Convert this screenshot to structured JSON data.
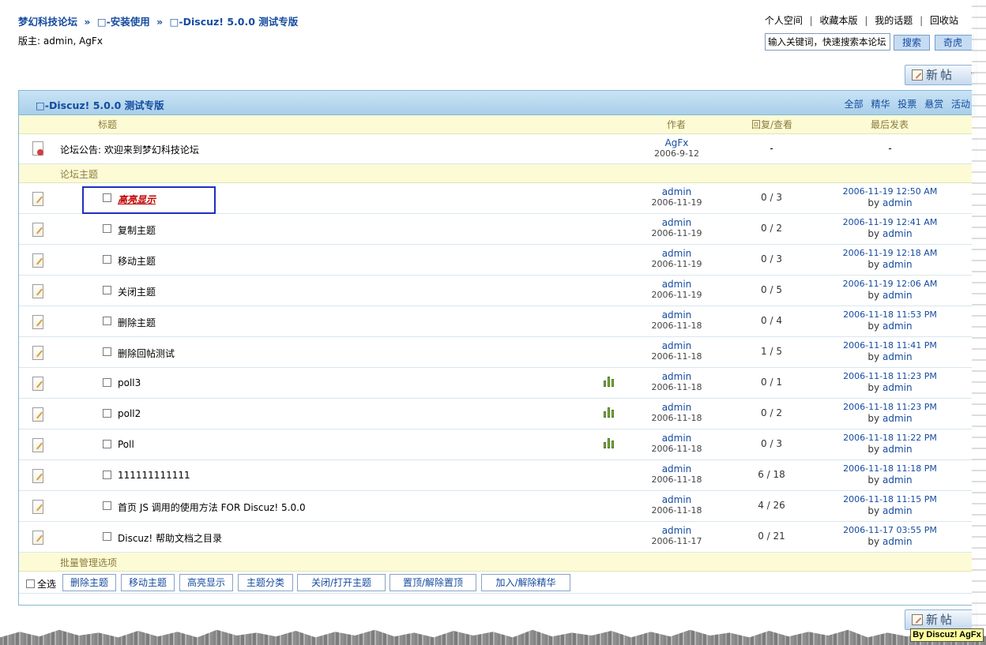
{
  "breadcrumb": {
    "forum_name": "梦幻科技论坛",
    "sep": "»",
    "level1": "□-安装使用",
    "level2": "□-Discuz! 5.0.0 测试专版"
  },
  "moderators": "版主: admin, AgFx",
  "topnav": {
    "space": "个人空间",
    "favorite": "收藏本版",
    "my_topics": "我的话题",
    "recycle": "回收站",
    "sep": "|"
  },
  "search": {
    "value": "输入关键词，快速搜索本论坛",
    "button": "搜索",
    "odd_button": "奇虎"
  },
  "newpost": {
    "label": "新帖",
    "caret": "▾"
  },
  "forum": {
    "title": "□-Discuz! 5.0.0 测试专版",
    "filters": [
      "全部",
      "精华",
      "投票",
      "悬赏",
      "活动"
    ]
  },
  "columns": {
    "title": "标题",
    "author": "作者",
    "replies": "回复/查看",
    "last": "最后发表"
  },
  "announcement": {
    "text": "论坛公告: 欢迎来到梦幻科技论坛",
    "author": "AgFx",
    "date": "2006-9-12",
    "stat": "-",
    "last": "-"
  },
  "section_label": "论坛主题",
  "threads": [
    {
      "title": "高亮显示",
      "author": "admin",
      "date": "2006-11-19",
      "stat": "0 / 3",
      "last_time": "2006-11-19 12:50 AM",
      "last_by": "by",
      "last_user": "admin"
    },
    {
      "title": "复制主题",
      "author": "admin",
      "date": "2006-11-19",
      "stat": "0 / 2",
      "last_time": "2006-11-19 12:41 AM",
      "last_by": "by",
      "last_user": "admin"
    },
    {
      "title": "移动主题",
      "author": "admin",
      "date": "2006-11-19",
      "stat": "0 / 3",
      "last_time": "2006-11-19 12:18 AM",
      "last_by": "by",
      "last_user": "admin"
    },
    {
      "title": "关闭主题",
      "author": "admin",
      "date": "2006-11-19",
      "stat": "0 / 5",
      "last_time": "2006-11-19 12:06 AM",
      "last_by": "by",
      "last_user": "admin"
    },
    {
      "title": "删除主题",
      "author": "admin",
      "date": "2006-11-18",
      "stat": "0 / 4",
      "last_time": "2006-11-18 11:53 PM",
      "last_by": "by",
      "last_user": "admin"
    },
    {
      "title": "删除回帖测试",
      "author": "admin",
      "date": "2006-11-18",
      "stat": "1 / 5",
      "last_time": "2006-11-18 11:41 PM",
      "last_by": "by",
      "last_user": "admin"
    },
    {
      "title": "poll3",
      "author": "admin",
      "date": "2006-11-18",
      "stat": "0 / 1",
      "last_time": "2006-11-18 11:23 PM",
      "last_by": "by",
      "last_user": "admin"
    },
    {
      "title": "poll2",
      "author": "admin",
      "date": "2006-11-18",
      "stat": "0 / 2",
      "last_time": "2006-11-18 11:23 PM",
      "last_by": "by",
      "last_user": "admin"
    },
    {
      "title": "Poll",
      "author": "admin",
      "date": "2006-11-18",
      "stat": "0 / 3",
      "last_time": "2006-11-18 11:22 PM",
      "last_by": "by",
      "last_user": "admin"
    },
    {
      "title": "111111111111",
      "author": "admin",
      "date": "2006-11-18",
      "stat": "6 / 18",
      "last_time": "2006-11-18 11:18 PM",
      "last_by": "by",
      "last_user": "admin"
    },
    {
      "title": "首页 JS 调用的使用方法 FOR Discuz! 5.0.0",
      "author": "admin",
      "date": "2006-11-18",
      "stat": "4 / 26",
      "last_time": "2006-11-18 11:15 PM",
      "last_by": "by",
      "last_user": "admin"
    },
    {
      "title": "Discuz! 帮助文档之目录",
      "author": "admin",
      "date": "2006-11-17",
      "stat": "0 / 21",
      "last_time": "2006-11-17 03:55 PM",
      "last_by": "by",
      "last_user": "admin"
    }
  ],
  "batch": {
    "label": "批量管理选项",
    "select_all": "全选",
    "buttons": [
      "删除主题",
      "移动主题",
      "高亮显示",
      "主题分类",
      "关闭/打开主题",
      "置顶/解除置顶",
      "加入/解除精华"
    ]
  },
  "watermark": "By Discuz! AgFx"
}
